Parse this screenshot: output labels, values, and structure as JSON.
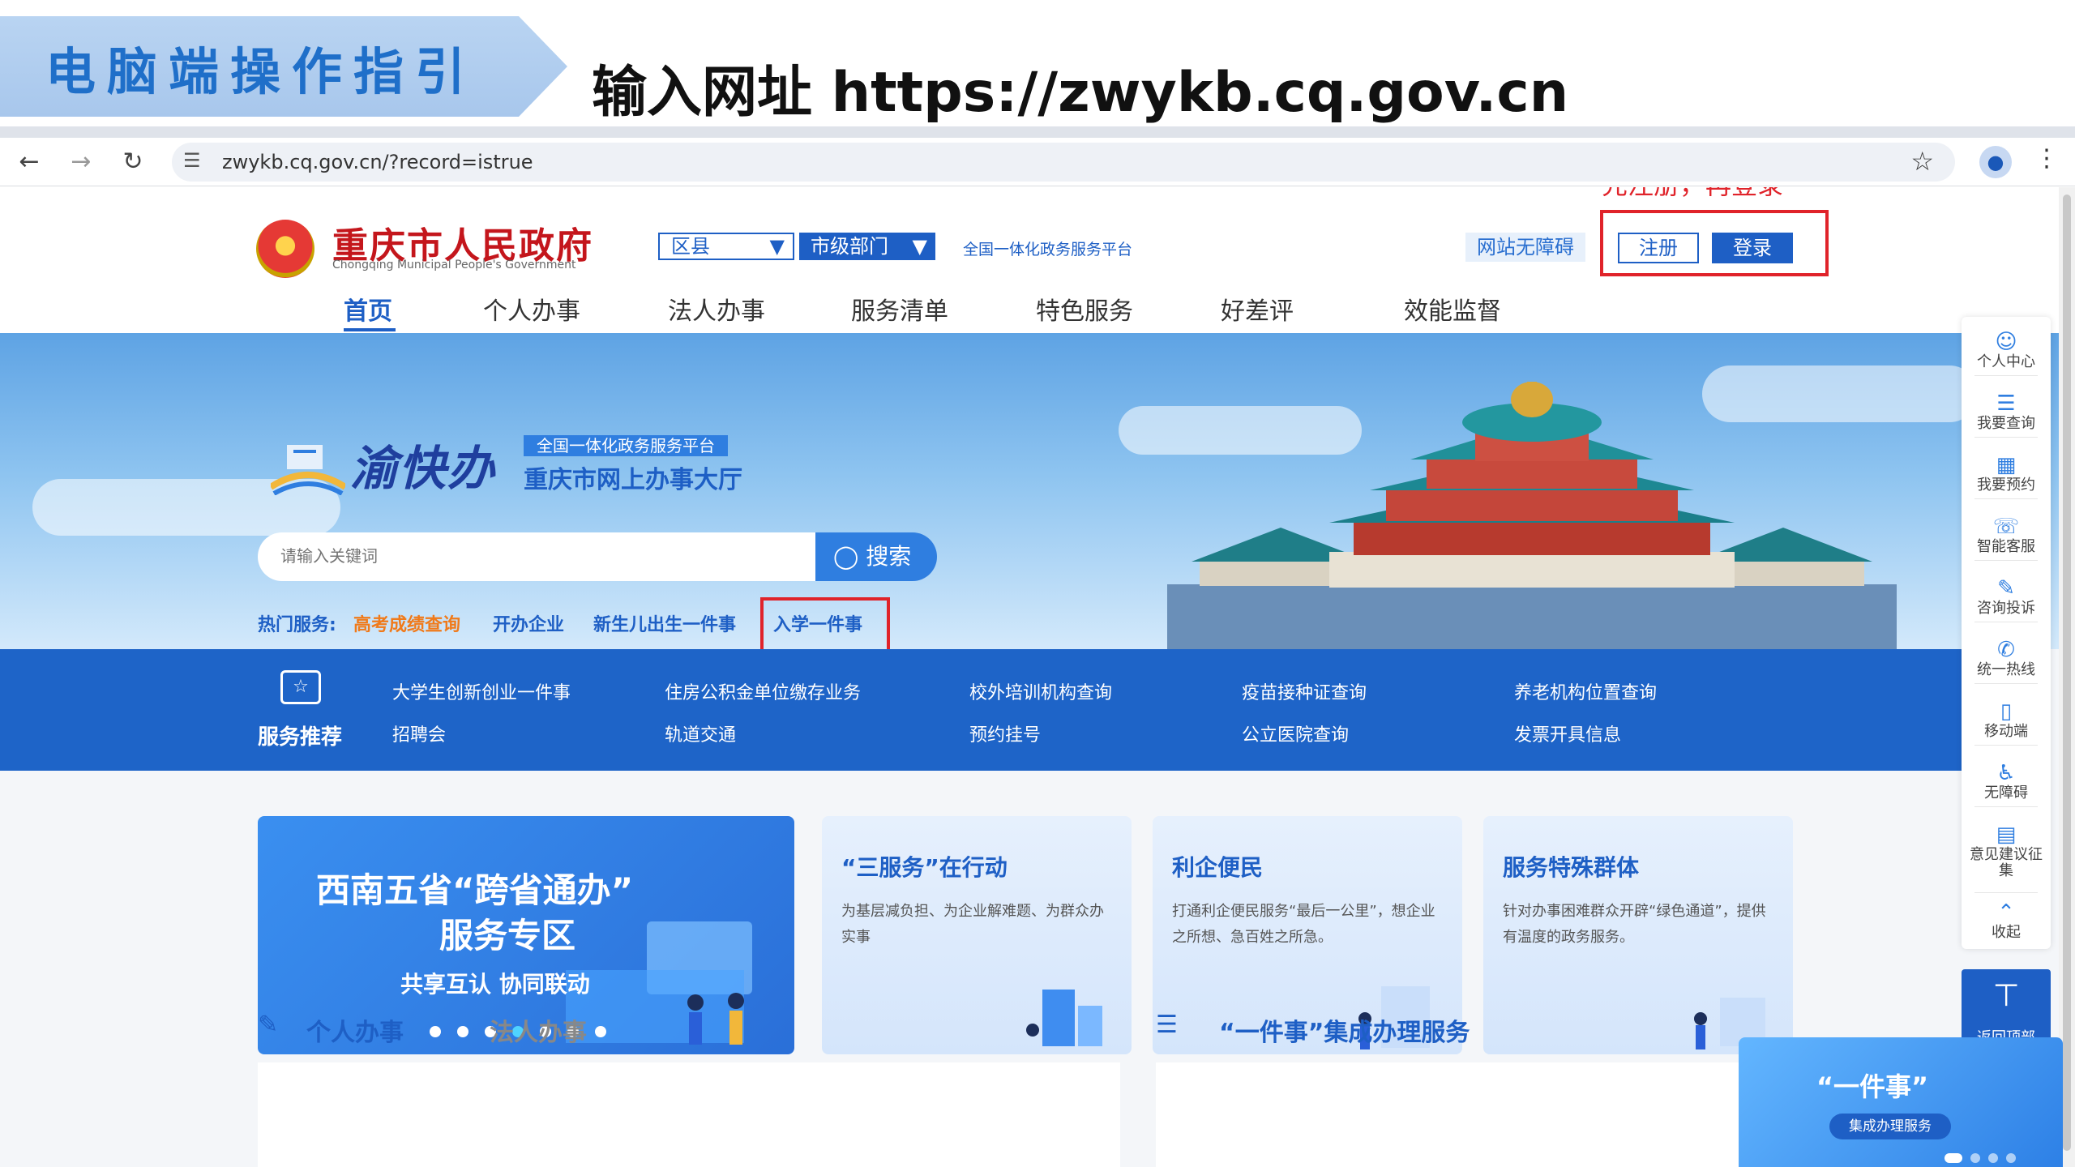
{
  "guide": {
    "title": "电脑端操作指引",
    "instruction": "输入网址  https://zwykb.cq.gov.cn"
  },
  "browser": {
    "url": "zwykb.cq.gov.cn/?record=istrue",
    "back_icon": "arrow-left-icon",
    "forward_icon": "arrow-right-icon",
    "reload_icon": "reload-icon"
  },
  "header": {
    "site_title": "重庆市人民政府",
    "site_subtitle": "Chongqing Municipal People's Government",
    "select_county": "区县",
    "select_city": "市级部门",
    "platform": "全国一体化政务服务平台",
    "accessibility": "网站无障碍",
    "register": "注册",
    "login": "登录",
    "register_note": "先注册，再登录"
  },
  "nav": [
    "首页",
    "个人办事",
    "法人办事",
    "服务清单",
    "特色服务",
    "好差评",
    "效能监督"
  ],
  "hero": {
    "brand_name": "渝快办",
    "brand_tag": "全国一体化政务服务平台",
    "brand_hall": "重庆市网上办事大厅",
    "search_placeholder": "请输入关键词",
    "search_button": "搜索",
    "hot_label": "热门服务:",
    "hot_items": [
      "高考成绩查询",
      "开办企业",
      "新生儿出生一件事",
      "入学一件事"
    ]
  },
  "services": {
    "title": "服务推荐",
    "links": [
      [
        "大学生创新创业一件事",
        "招聘会"
      ],
      [
        "住房公积金单位缴存业务",
        "轨道交通"
      ],
      [
        "校外培训机构查询",
        "预约挂号"
      ],
      [
        "疫苗接种证查询",
        "公立医院查询"
      ],
      [
        "养老机构位置查询",
        "发票开具信息"
      ]
    ]
  },
  "cards": {
    "main": {
      "line1": "西南五省“跨省通办”",
      "line2": "服务专区",
      "line3": "共享互认  协同联动"
    },
    "items": [
      {
        "title": "“三服务”在行动",
        "text": "为基层减负担、为企业解难题、为群众办实事"
      },
      {
        "title": "利企便民",
        "text": "打通利企便民服务“最后一公里”，想企业之所想、急百姓之所急。"
      },
      {
        "title": "服务特殊群体",
        "text": "针对办事困难群众开辟“绿色通道”，提供有温度的政务服务。"
      }
    ]
  },
  "bottom": {
    "tab_personal": "个人办事",
    "tab_legal": "法人办事",
    "integrated": "“一件事”集成办理服务"
  },
  "toolbar": [
    {
      "label": "个人中心",
      "icon": "user-icon"
    },
    {
      "label": "我要查询",
      "icon": "search-list-icon"
    },
    {
      "label": "我要预约",
      "icon": "calendar-icon"
    },
    {
      "label": "智能客服",
      "icon": "headset-icon"
    },
    {
      "label": "咨询投诉",
      "icon": "edit-icon"
    },
    {
      "label": "统一热线",
      "icon": "phone-icon"
    },
    {
      "label": "移动端",
      "icon": "mobile-icon"
    },
    {
      "label": "无障碍",
      "icon": "wheelchair-icon"
    },
    {
      "label": "意见建议征集",
      "icon": "feedback-icon"
    },
    {
      "label": "收起",
      "icon": "chevron-up-icon"
    }
  ],
  "back_top": "返回顶部",
  "popup": {
    "title": "“一件事”",
    "pill": "集成办理服务"
  },
  "colors": {
    "primary": "#1e5fc5",
    "highlight": "#e0232a",
    "hot_orange": "#f07a1a"
  }
}
